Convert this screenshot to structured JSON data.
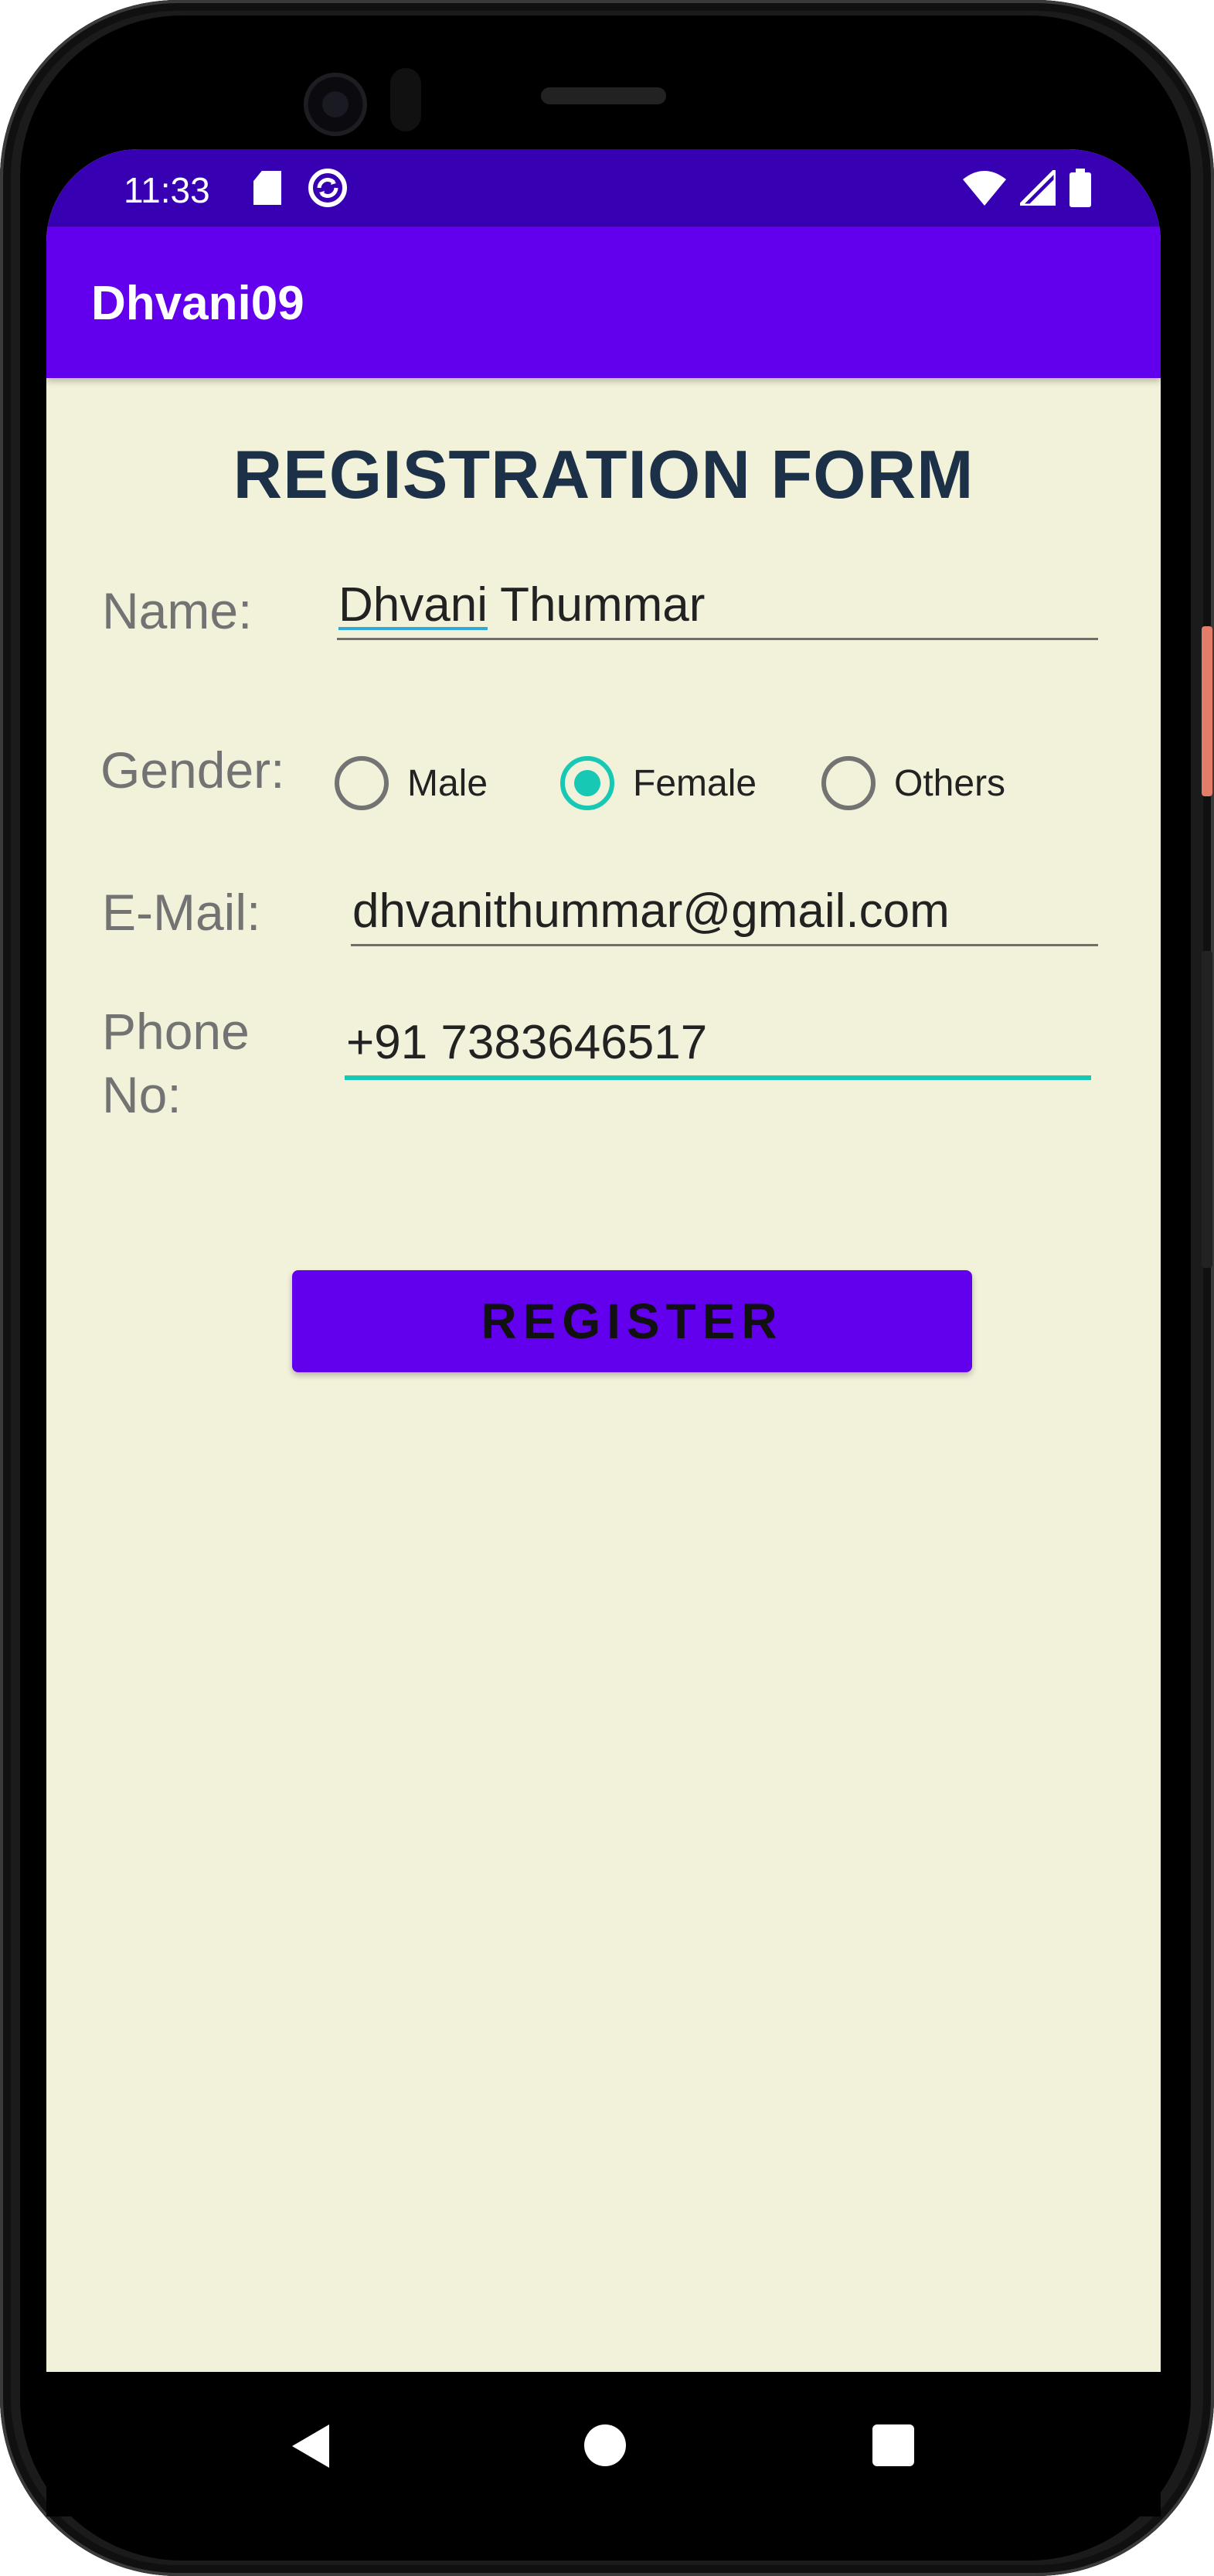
{
  "status_bar": {
    "time": "11:33",
    "icons": [
      "sd-card-icon",
      "sync-icon",
      "wifi-icon",
      "signal-icon",
      "battery-icon"
    ]
  },
  "app_bar": {
    "title": "Dhvani09"
  },
  "form": {
    "title": "REGISTRATION FORM",
    "name": {
      "label": "Name:",
      "value_first": "Dhvani",
      "value_rest": " Thummar"
    },
    "gender": {
      "label": "Gender:",
      "options": [
        "Male",
        "Female",
        "Others"
      ],
      "selected": "Female"
    },
    "email": {
      "label": "E-Mail:",
      "value": "dhvanithummar@gmail.com"
    },
    "phone": {
      "label": "Phone No:",
      "value": "+91 7383646517"
    },
    "register_label": "REGISTER"
  },
  "colors": {
    "primary": "#6200ee",
    "primary_dark": "#3700b3",
    "accent": "#17c9b4",
    "background": "#f2f2da",
    "title_text": "#1c3148"
  },
  "nav_bar": {
    "icons": [
      "back-icon",
      "home-icon",
      "recents-icon"
    ]
  }
}
